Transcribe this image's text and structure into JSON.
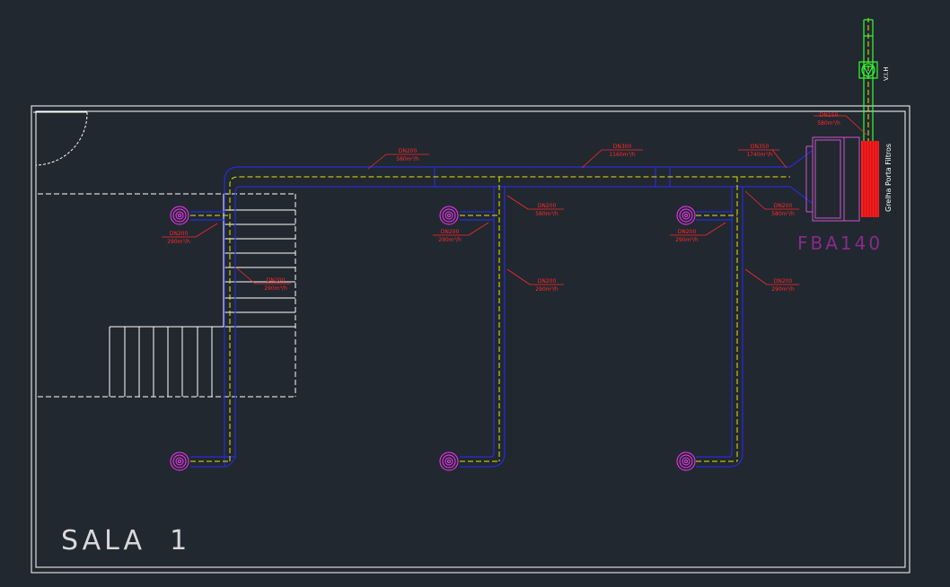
{
  "room": {
    "name": "SALA  1"
  },
  "unit": {
    "name": "FBA140"
  },
  "grille": {
    "label": "Grelha Porta Filtros"
  },
  "fan": {
    "label": "V.I.H"
  },
  "duct_labels": [
    {
      "id": "main-1",
      "dn": "DN200",
      "flow": "580m³/h"
    },
    {
      "id": "main-2",
      "dn": "DN300",
      "flow": "1160m³/h"
    },
    {
      "id": "main-3",
      "dn": "DN350",
      "flow": "1740m³/h"
    },
    {
      "id": "intake",
      "dn": "DN150",
      "flow": "580m³/h"
    },
    {
      "id": "b1-top",
      "dn": "DN200",
      "flow": "290m³/h"
    },
    {
      "id": "b1-mid",
      "dn": "DN200",
      "flow": "290m³/h"
    },
    {
      "id": "b2-top",
      "dn": "DN200",
      "flow": "580m³/h"
    },
    {
      "id": "b2-dif",
      "dn": "DN200",
      "flow": "290m³/h"
    },
    {
      "id": "b2-mid",
      "dn": "DN200",
      "flow": "290m³/h"
    },
    {
      "id": "b3-top",
      "dn": "DN200",
      "flow": "580m³/h"
    },
    {
      "id": "b3-dif",
      "dn": "DN200",
      "flow": "290m³/h"
    },
    {
      "id": "b3-mid",
      "dn": "DN200",
      "flow": "290m³/h"
    }
  ],
  "colors": {
    "wall": "#ffffff",
    "duct": "#2b2bd6",
    "centerline": "#e6e600",
    "diffuser": "#ff33ff",
    "label": "#ff2a2a",
    "grille": "#ff2020",
    "fan": "#33ff33",
    "unit": "#cc55cc"
  }
}
